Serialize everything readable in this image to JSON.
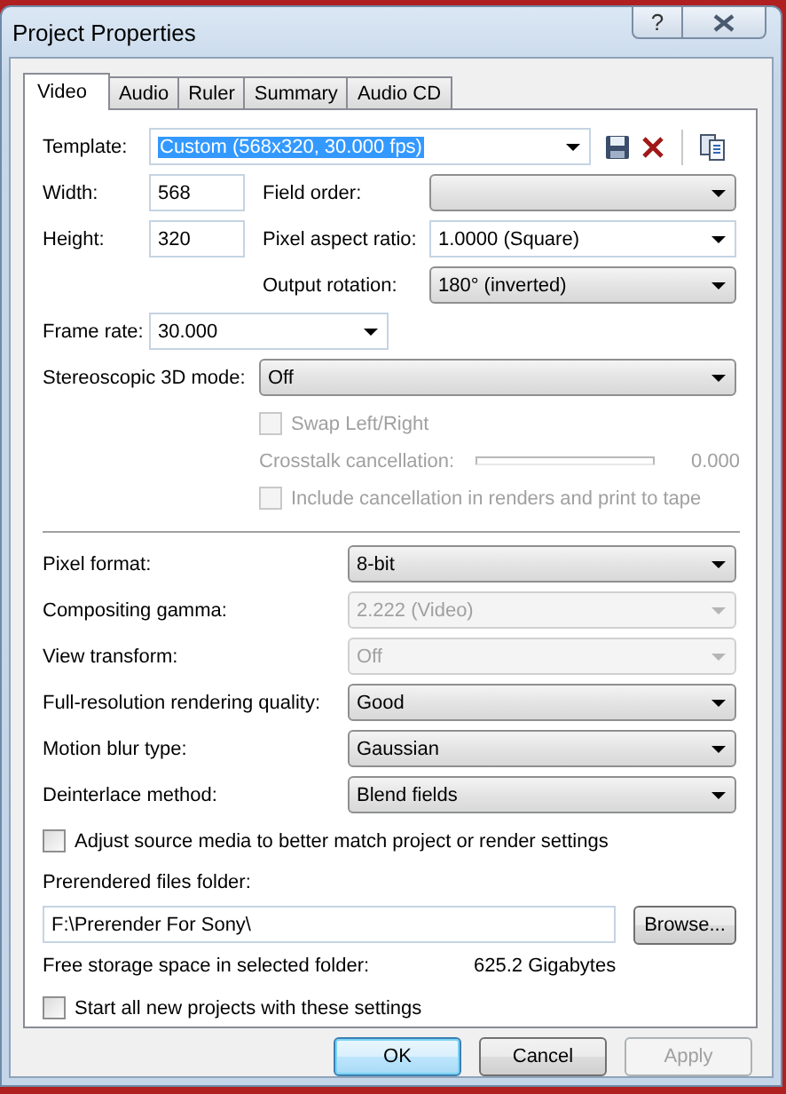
{
  "window": {
    "title": "Project Properties",
    "help": "?"
  },
  "tabs": [
    {
      "label": "Video",
      "selected": true
    },
    {
      "label": "Audio",
      "selected": false
    },
    {
      "label": "Ruler",
      "selected": false
    },
    {
      "label": "Summary",
      "selected": false
    },
    {
      "label": "Audio CD",
      "selected": false
    }
  ],
  "template": {
    "label": "Template:",
    "value": "Custom (568x320, 30.000 fps)",
    "text_selected": true
  },
  "width": {
    "label": "Width:",
    "value": "568"
  },
  "height": {
    "label": "Height:",
    "value": "320"
  },
  "field_order": {
    "label": "Field order:"
  },
  "pixel_aspect_ratio": {
    "label": "Pixel aspect ratio:",
    "value": "1.0000 (Square)"
  },
  "output_rotation": {
    "label": "Output rotation:",
    "value": "180° (inverted)"
  },
  "frame_rate": {
    "label": "Frame rate:",
    "value": "30.000"
  },
  "stereoscopic_3d_mode": {
    "label": "Stereoscopic 3D mode:",
    "value": "Off"
  },
  "swap_left_right": {
    "label": "Swap Left/Right",
    "checked": false,
    "disabled": true
  },
  "crosstalk_cancellation": {
    "label": "Crosstalk cancellation:",
    "reading": "0.000",
    "disabled": true
  },
  "include_cancellation": {
    "label": "Include cancellation in renders and print to tape",
    "checked": false,
    "disabled": true
  },
  "settings": [
    {
      "label": "Pixel format:",
      "value": "8-bit",
      "disabled": false
    },
    {
      "label": "Compositing gamma:",
      "value": "2.222 (Video)",
      "disabled": true
    },
    {
      "label": "View transform:",
      "value": "Off",
      "disabled": true
    },
    {
      "label": "Full-resolution rendering quality:",
      "value": "Good",
      "disabled": false
    },
    {
      "label": "Motion blur type:",
      "value": "Gaussian",
      "disabled": false
    },
    {
      "label": "Deinterlace method:",
      "value": "Blend fields",
      "disabled": false
    }
  ],
  "adjust_source_media": {
    "label": "Adjust source media to better match project or render settings",
    "checked": false
  },
  "prerendered_files_folder": {
    "label": "Prerendered files folder:",
    "value": "F:\\Prerender For Sony\\",
    "browse": "Browse..."
  },
  "free_storage": {
    "label": "Free storage space in selected folder:",
    "value": "625.2 Gigabytes"
  },
  "start_all_new_projects": {
    "label": "Start all new projects with these settings",
    "checked": false
  },
  "buttons": [
    {
      "label": "OK",
      "kind": "default",
      "disabled": false
    },
    {
      "label": "Cancel",
      "kind": "normal",
      "disabled": false
    },
    {
      "label": "Apply",
      "kind": "normal",
      "disabled": true
    }
  ]
}
